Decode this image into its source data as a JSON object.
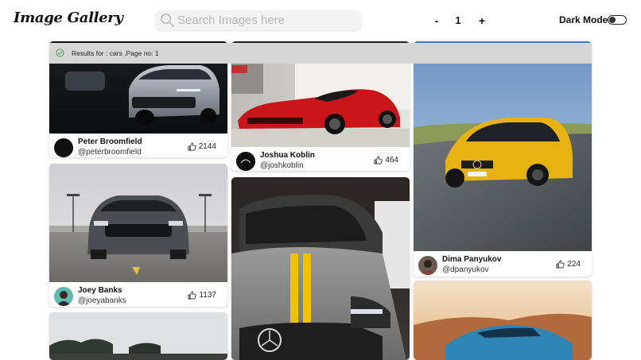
{
  "app": {
    "title": "Image Gallery"
  },
  "search": {
    "placeholder": "Search Images here",
    "value": ""
  },
  "pagination": {
    "prev_label": "-",
    "page": "1",
    "next_label": "+"
  },
  "theme": {
    "dark_mode_label": "Dark Mode",
    "dark_mode_on": false
  },
  "banner": {
    "text": "Results for : cars ,Page no: 1"
  },
  "columns": [
    [
      {
        "name": "Peter Broomfield",
        "handle": "@peterbroomfield",
        "likes": "2144"
      },
      {
        "name": "Joey Banks",
        "handle": "@joeyabanks",
        "likes": "1137"
      }
    ],
    [
      {
        "name": "Joshua Koblin",
        "handle": "@joshkoblin",
        "likes": "464"
      }
    ],
    [
      {
        "name": "Dima Panyukov",
        "handle": "@dpanyukov",
        "likes": "224"
      }
    ]
  ],
  "colors": {
    "banner_bg": "#d7d7d7",
    "success_green": "#3aa35a",
    "accent": "#222222"
  }
}
